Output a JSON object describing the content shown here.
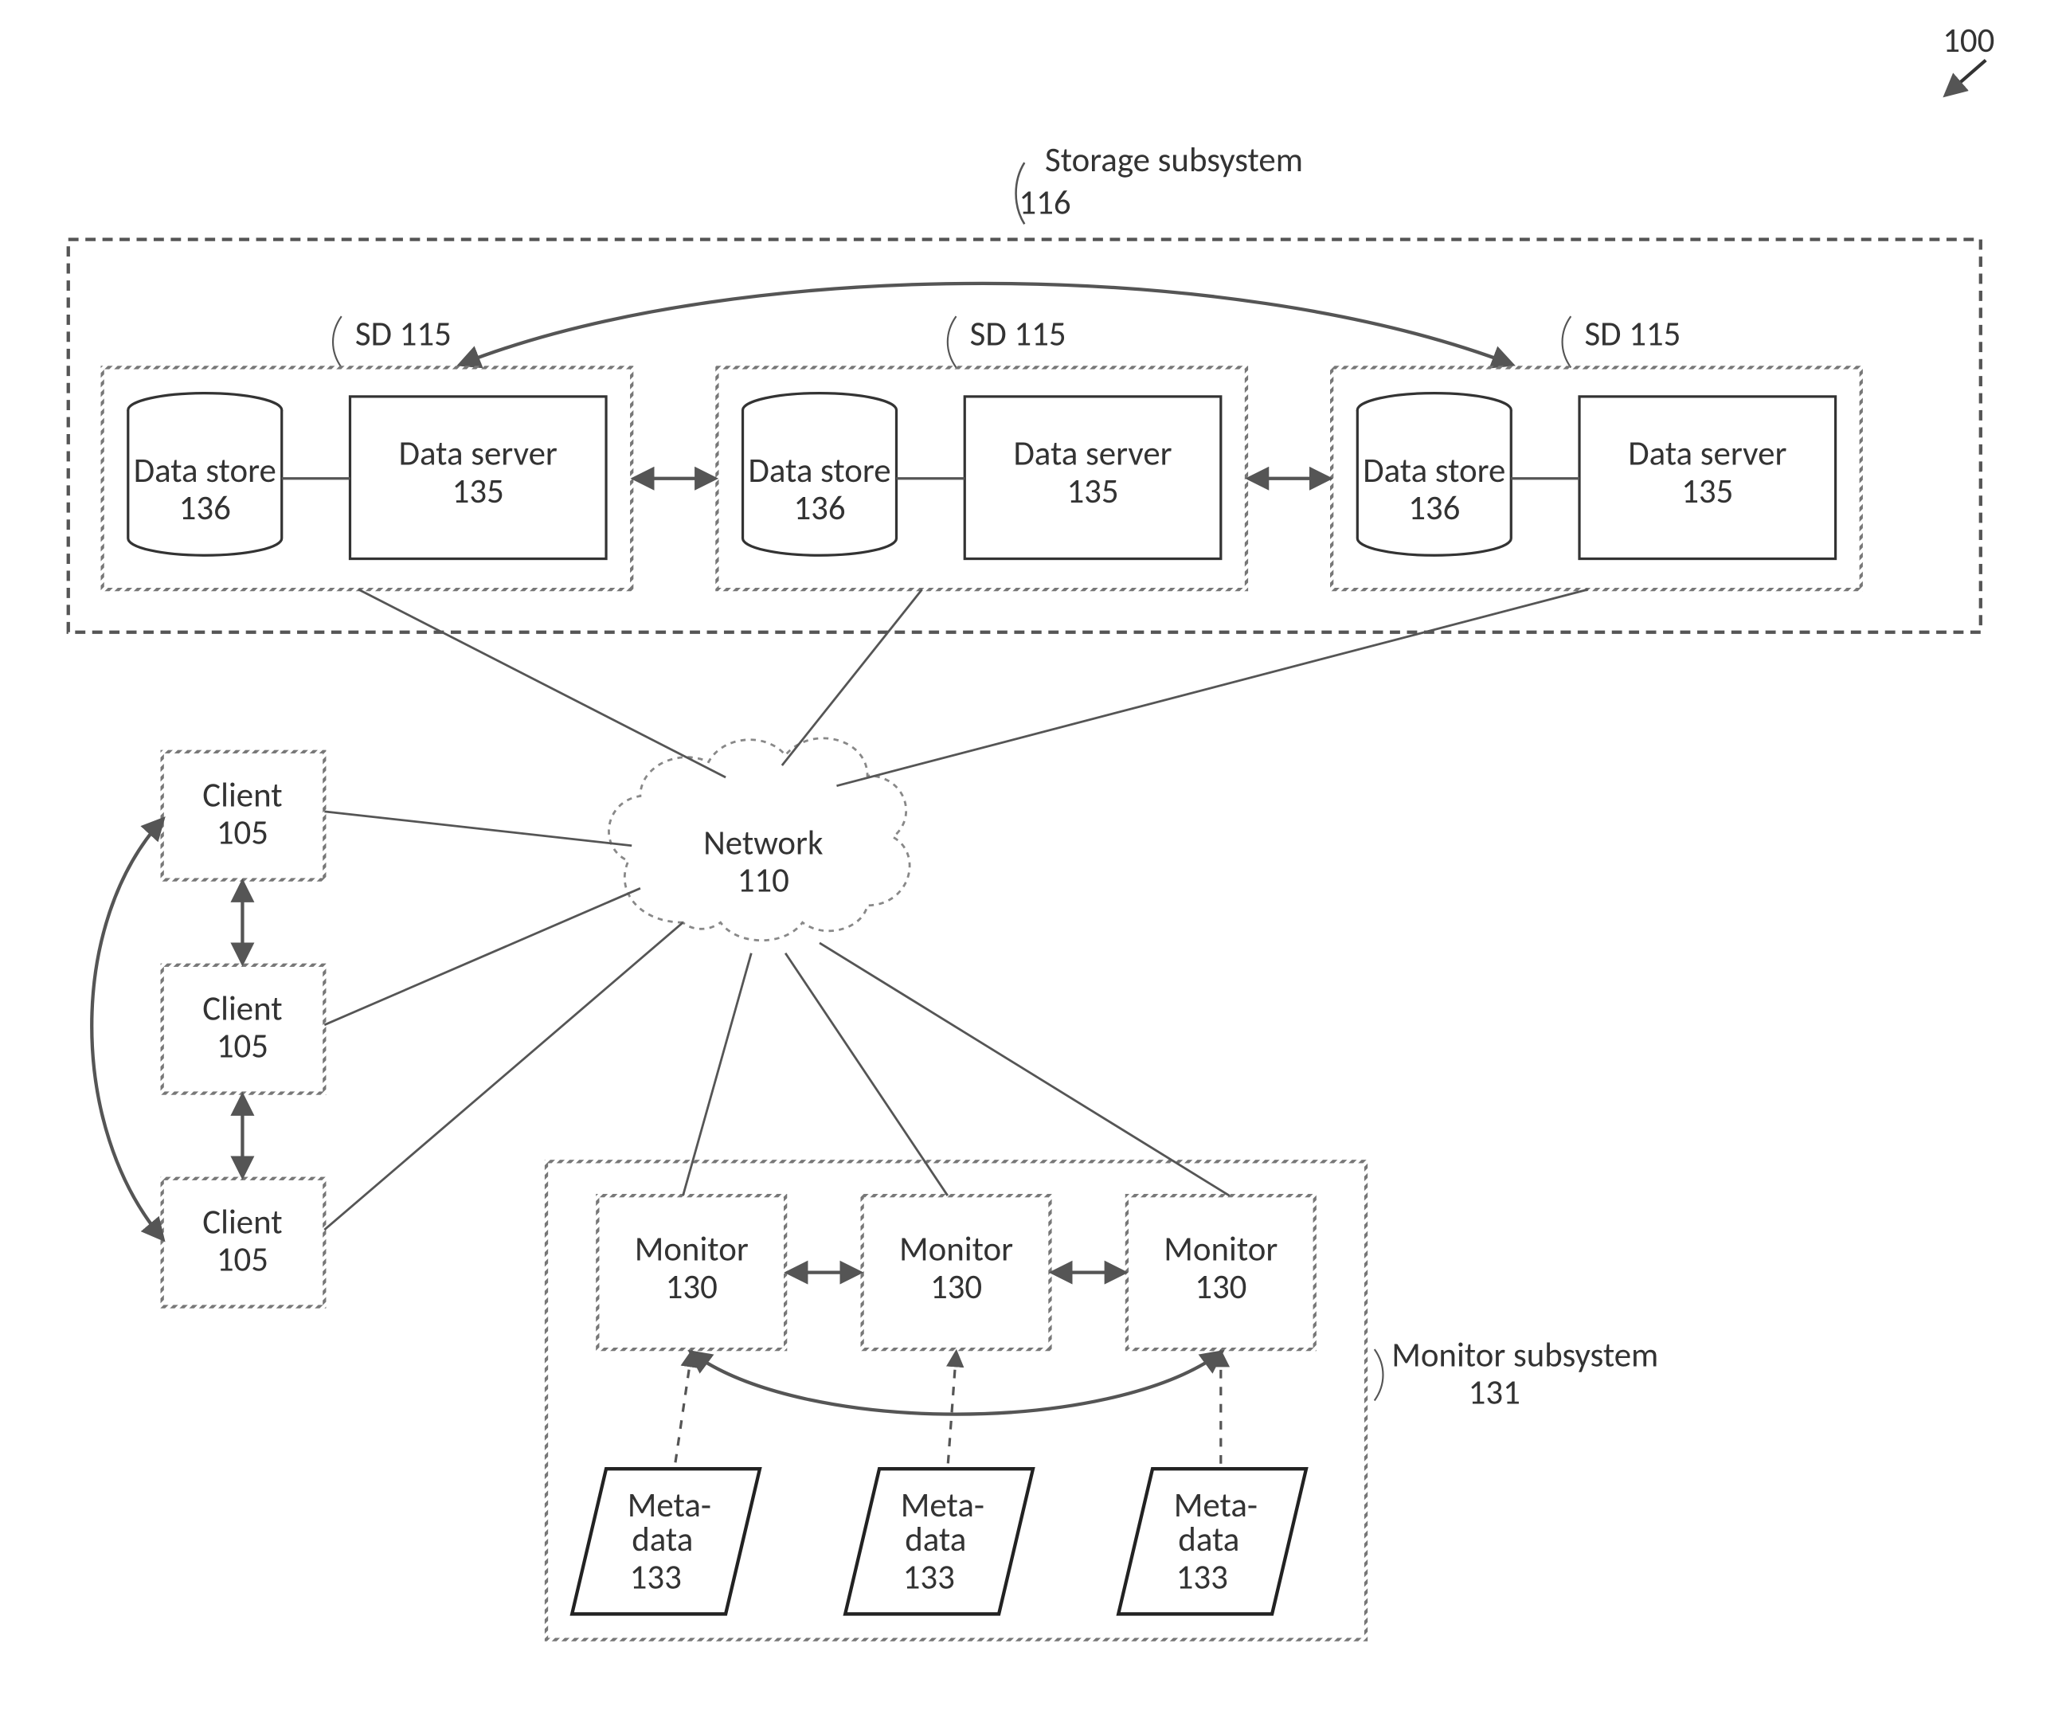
{
  "figure_number": "100",
  "storage_subsystem": {
    "label": "Storage subsystem",
    "ref": "116",
    "sd_label": "SD 115",
    "data_store_label": "Data store",
    "data_store_ref": "136",
    "data_server_label": "Data server",
    "data_server_ref": "135"
  },
  "network": {
    "label": "Network",
    "ref": "110"
  },
  "clients": {
    "label": "Client",
    "ref": "105"
  },
  "monitor_subsystem": {
    "label": "Monitor subsystem",
    "ref": "131",
    "monitor_label": "Monitor",
    "monitor_ref": "130",
    "metadata_label_a": "Meta-",
    "metadata_label_b": "data",
    "metadata_ref": "133"
  }
}
